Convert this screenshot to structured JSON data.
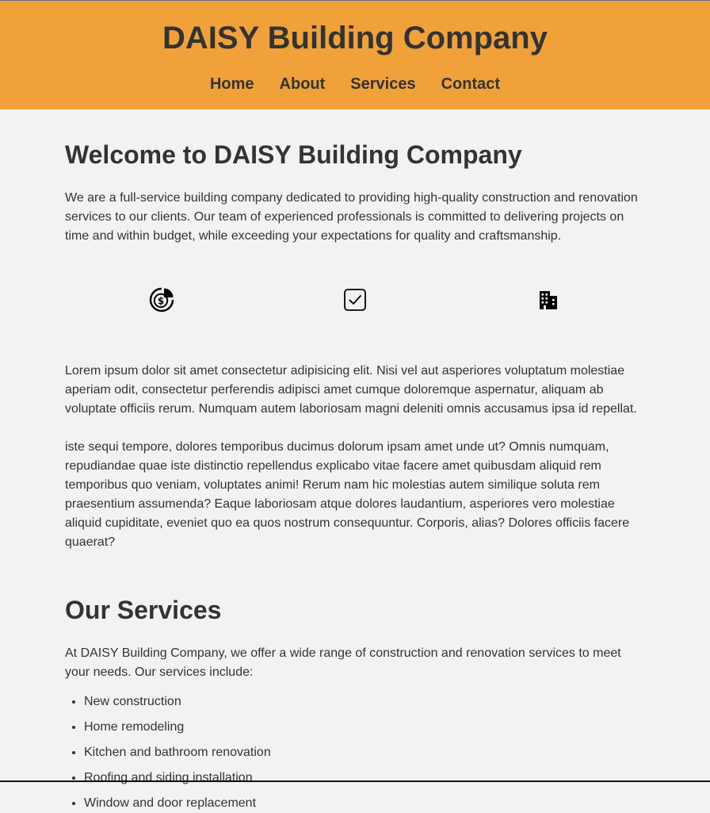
{
  "header": {
    "title": "DAISY Building Company",
    "background": "#f0a13a",
    "nav": [
      {
        "label": "Home"
      },
      {
        "label": "About"
      },
      {
        "label": "Services"
      },
      {
        "label": "Contact"
      }
    ]
  },
  "main": {
    "welcome_title": "Welcome to DAISY Building Company",
    "welcome_text": "We are a full-service building company dedicated to providing high-quality construction and renovation services to our clients. Our team of experienced professionals is committed to delivering projects on time and within budget, while exceeding your expectations for quality and craftsmanship.",
    "icons": [
      "budget-chart-icon",
      "checkbox-icon",
      "building-icon"
    ],
    "lorem_1": "Lorem ipsum dolor sit amet consectetur adipisicing elit. Nisi vel aut asperiores voluptatum molestiae aperiam odit, consectetur perferendis adipisci amet cumque doloremque aspernatur, aliquam ab voluptate officiis rerum. Numquam autem laboriosam magni deleniti omnis accusamus ipsa id repellat.",
    "lorem_2": "iste sequi tempore, dolores temporibus ducimus dolorum ipsam amet unde ut? Omnis numquam, repudiandae quae iste distinctio repellendus explicabo vitae facere amet quibusdam aliquid rem temporibus quo veniam, voluptates animi! Rerum nam hic molestias autem similique soluta rem praesentium assumenda? Eaque laboriosam atque dolores laudantium, asperiores vero molestiae aliquid cupiditate, eveniet quo ea quos nostrum consequuntur. Corporis, alias? Dolores officiis facere quaerat?",
    "services_title": "Our Services",
    "services_intro": "At DAISY Building Company, we offer a wide range of construction and renovation services to meet your needs. Our services include:",
    "services": [
      "New construction",
      "Home remodeling",
      "Kitchen and bathroom renovation",
      "Roofing and siding installation",
      "Window and door replacement"
    ]
  }
}
